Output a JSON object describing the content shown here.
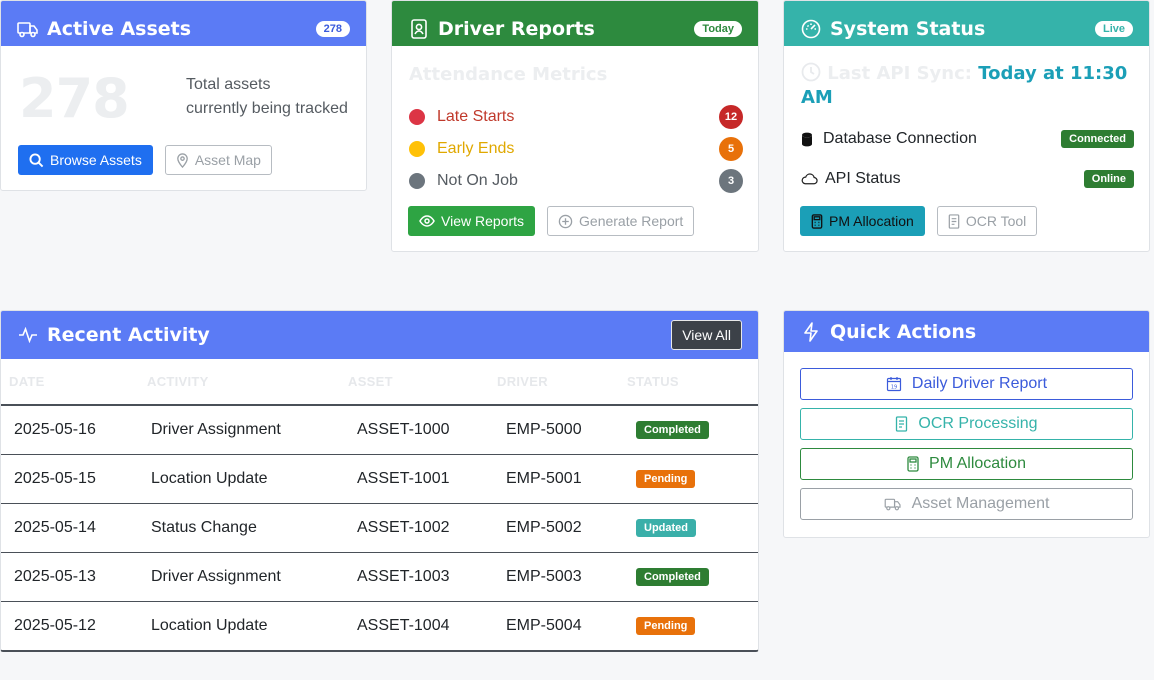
{
  "active_assets": {
    "title": "Active Assets",
    "pill": "278",
    "count": "278",
    "desc_line1": "Total assets",
    "desc_line2": "currently being tracked",
    "browse_label": "Browse Assets",
    "map_label": "Asset Map"
  },
  "driver_reports": {
    "title": "Driver Reports",
    "pill": "Today",
    "subtitle": "Attendance Metrics",
    "metrics": [
      {
        "label": "Late Starts",
        "count": "12",
        "dot_color": "#dc3545",
        "label_color": "#c0392b",
        "badge_color": "#c62828"
      },
      {
        "label": "Early Ends",
        "count": "5",
        "dot_color": "#ffc107",
        "label_color": "#e0a800",
        "badge_color": "#e8710a"
      },
      {
        "label": "Not On Job",
        "count": "3",
        "dot_color": "#6c757d",
        "label_color": "#555b61",
        "badge_color": "#6c757d"
      }
    ],
    "view_label": "View Reports",
    "generate_label": "Generate Report"
  },
  "system_status": {
    "title": "System Status",
    "pill": "Live",
    "sync_label": "Last API Sync:",
    "sync_value": "Today at 11:30 AM",
    "db_label": "Database Connection",
    "db_status": "Connected",
    "api_label": "API Status",
    "api_status": "Online",
    "pm_label": "PM Allocation",
    "ocr_label": "OCR Tool"
  },
  "recent_activity": {
    "title": "Recent Activity",
    "view_all": "View All",
    "columns": [
      "DATE",
      "ACTIVITY",
      "ASSET",
      "DRIVER",
      "STATUS"
    ],
    "rows": [
      {
        "date": "2025-05-16",
        "activity": "Driver Assignment",
        "asset": "ASSET-1000",
        "driver": "EMP-5000",
        "status": "Completed",
        "status_color": "#2e7d32"
      },
      {
        "date": "2025-05-15",
        "activity": "Location Update",
        "asset": "ASSET-1001",
        "driver": "EMP-5001",
        "status": "Pending",
        "status_color": "#e8710a"
      },
      {
        "date": "2025-05-14",
        "activity": "Status Change",
        "asset": "ASSET-1002",
        "driver": "EMP-5002",
        "status": "Updated",
        "status_color": "#3aafa9"
      },
      {
        "date": "2025-05-13",
        "activity": "Driver Assignment",
        "asset": "ASSET-1003",
        "driver": "EMP-5003",
        "status": "Completed",
        "status_color": "#2e7d32"
      },
      {
        "date": "2025-05-12",
        "activity": "Location Update",
        "asset": "ASSET-1004",
        "driver": "EMP-5004",
        "status": "Pending",
        "status_color": "#e8710a"
      }
    ]
  },
  "quick_actions": {
    "title": "Quick Actions",
    "items": [
      {
        "label": "Daily Driver Report",
        "icon": "calendar-icon",
        "color": "#3b5bdb"
      },
      {
        "label": "OCR Processing",
        "icon": "document-icon",
        "color": "#35b3aa"
      },
      {
        "label": "PM Allocation",
        "icon": "calculator-icon",
        "color": "#2d8a3e"
      },
      {
        "label": "Asset Management",
        "icon": "truck-icon",
        "color": "#9aa0a6"
      }
    ]
  },
  "colors": {
    "blue_header": "#5b7bf5",
    "green_header": "#2d8a3e",
    "teal_header": "#35b3aa"
  }
}
